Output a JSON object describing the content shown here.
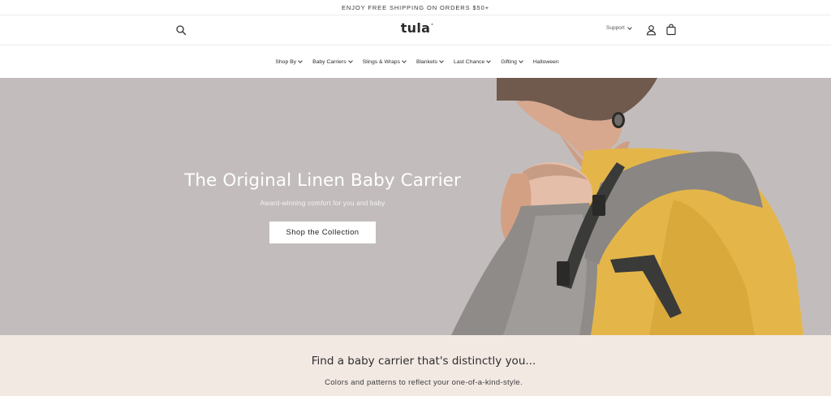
{
  "announcement": {
    "text": "ENJOY FREE SHIPPING ON ORDERS $50+"
  },
  "header": {
    "logo": "tula",
    "logo_mark": "®",
    "support_label": "Support",
    "icons": {
      "search": "search-icon",
      "account": "account-icon",
      "cart": "cart-icon"
    }
  },
  "nav": {
    "items": [
      {
        "label": "Shop By",
        "dropdown": true
      },
      {
        "label": "Baby Carriers",
        "dropdown": true
      },
      {
        "label": "Slings & Wraps",
        "dropdown": true
      },
      {
        "label": "Blankets",
        "dropdown": true
      },
      {
        "label": "Last Chance",
        "dropdown": true
      },
      {
        "label": "Gifting",
        "dropdown": true
      },
      {
        "label": "Halloween",
        "dropdown": false
      }
    ]
  },
  "hero": {
    "title": "The Original Linen Baby Carrier",
    "subtitle": "Award-winning comfort for you and baby",
    "cta": "Shop the Collection",
    "image": "parent-with-baby-in-linen-carrier",
    "background_color": "#c2bdbc"
  },
  "promo": {
    "title": "Find a baby carrier that's distinctly you...",
    "subtitle": "Colors and patterns to reflect your one-of-a-kind-style.",
    "background_color": "#f3e9e3"
  }
}
